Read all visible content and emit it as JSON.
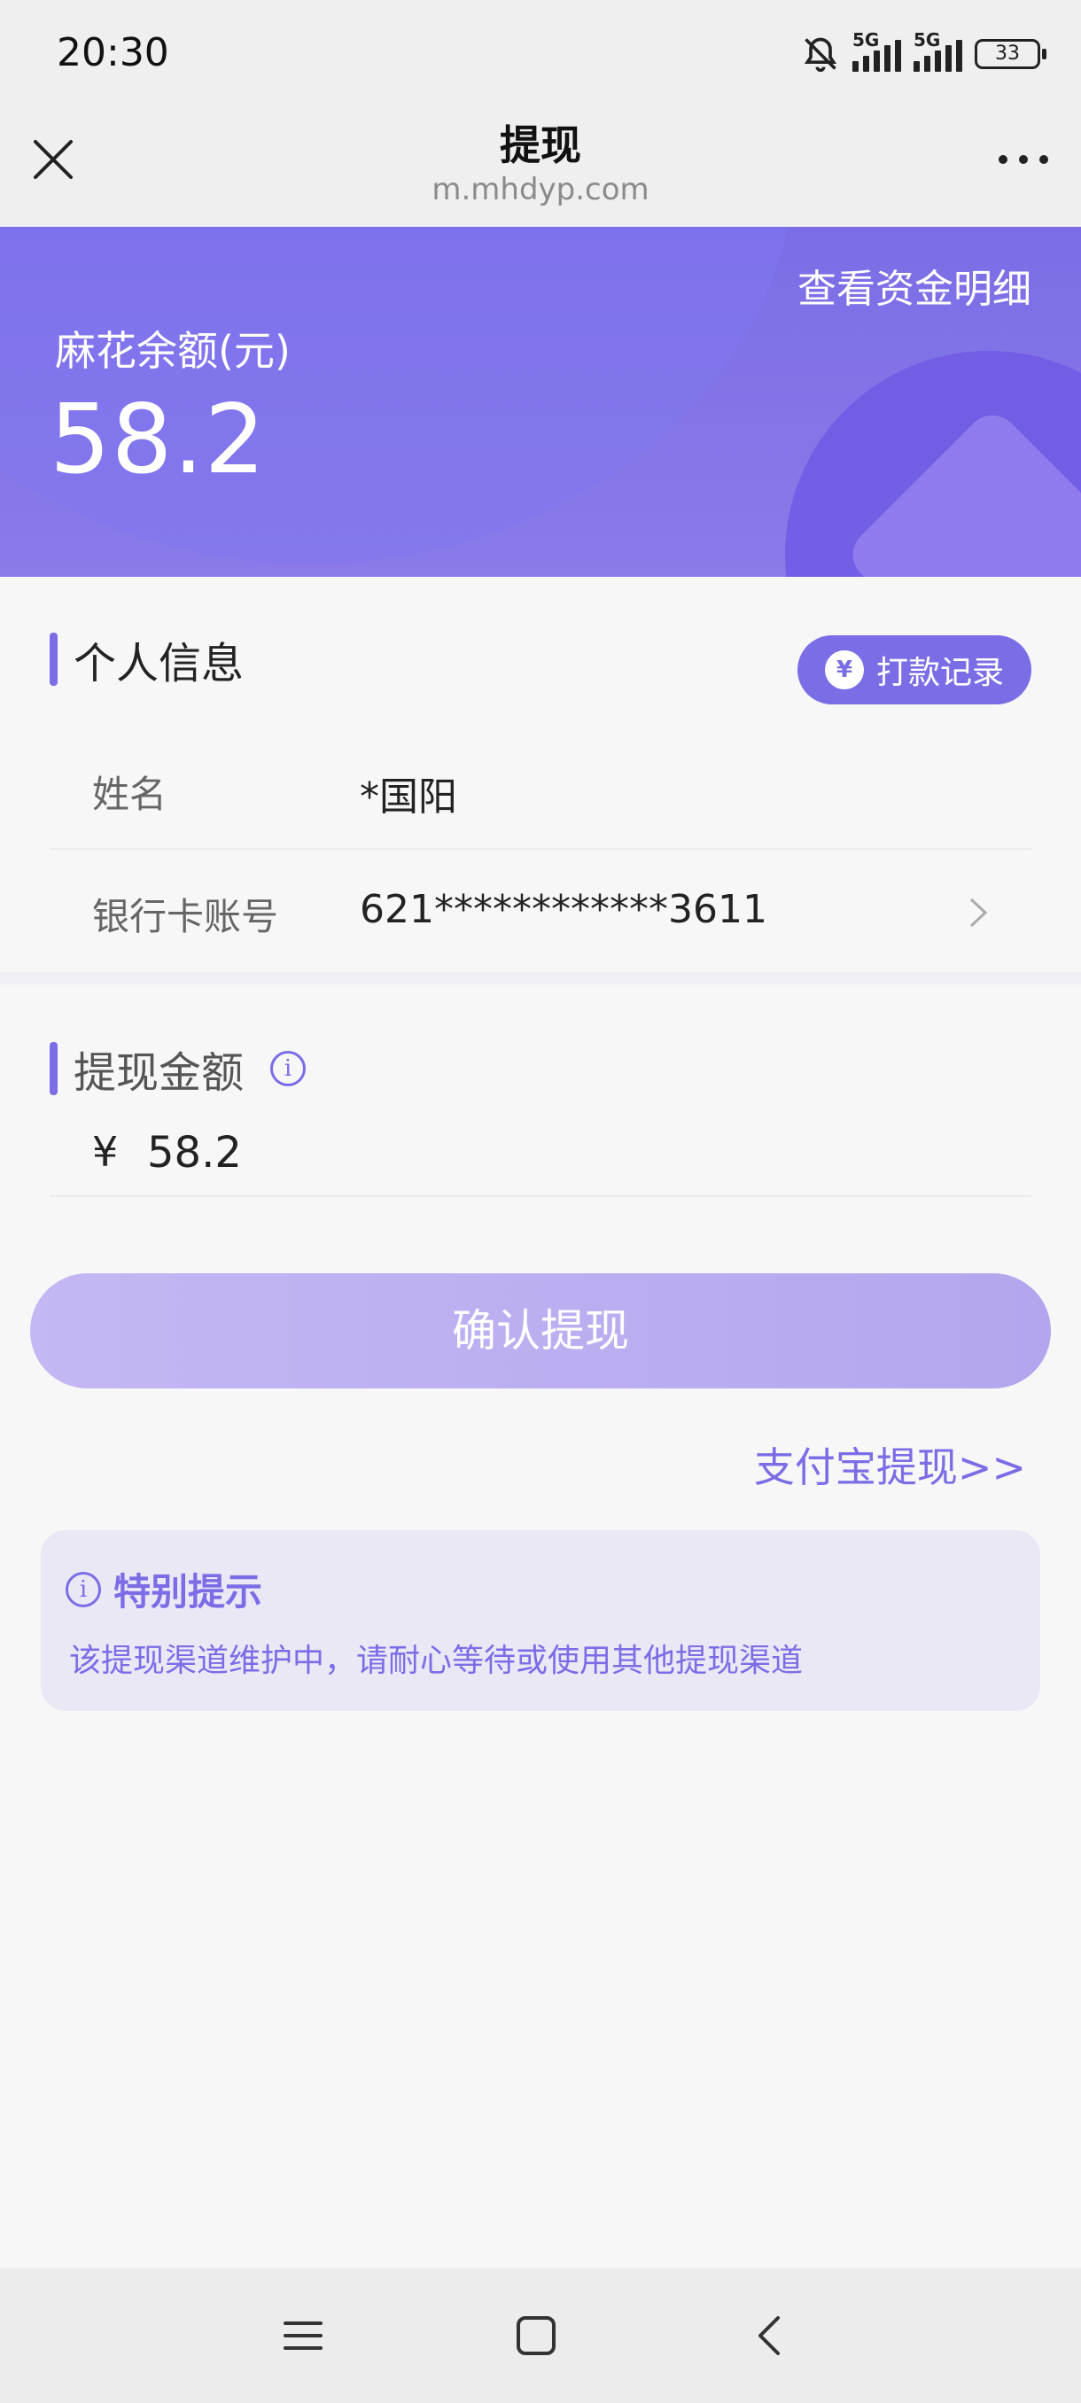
{
  "status_bar": {
    "time": "20:30",
    "network1": "5G",
    "network2": "5G",
    "battery": "33",
    "icons": [
      "mute-bell-icon",
      "signal-icon",
      "signal-icon",
      "battery-icon"
    ]
  },
  "title_bar": {
    "title": "提现",
    "subtitle": "m.mhdyp.com",
    "close_icon": "close-icon",
    "more_icon": "more-icon"
  },
  "banner": {
    "detail_link": "查看资金明细",
    "balance_label": "麻花余额(元)",
    "balance_value": "58.2"
  },
  "personal_info": {
    "section_title": "个人信息",
    "record_button": "打款记录",
    "record_icon_glyph": "¥",
    "name_label": "姓名",
    "name_value": "*国阳",
    "card_label": "银行卡账号",
    "card_value": "621************3611"
  },
  "withdraw": {
    "section_title": "提现金额",
    "currency_symbol": "¥",
    "amount": "58.2",
    "confirm_button": "确认提现",
    "alipay_link": "支付宝提现>>"
  },
  "notice": {
    "title": "特别提示",
    "body": "该提现渠道维护中，请耐心等待或使用其他提现渠道"
  },
  "colors": {
    "accent": "#7b6de6",
    "button_disabled": "#bcaef1",
    "notice_bg": "#ebe8f6"
  }
}
